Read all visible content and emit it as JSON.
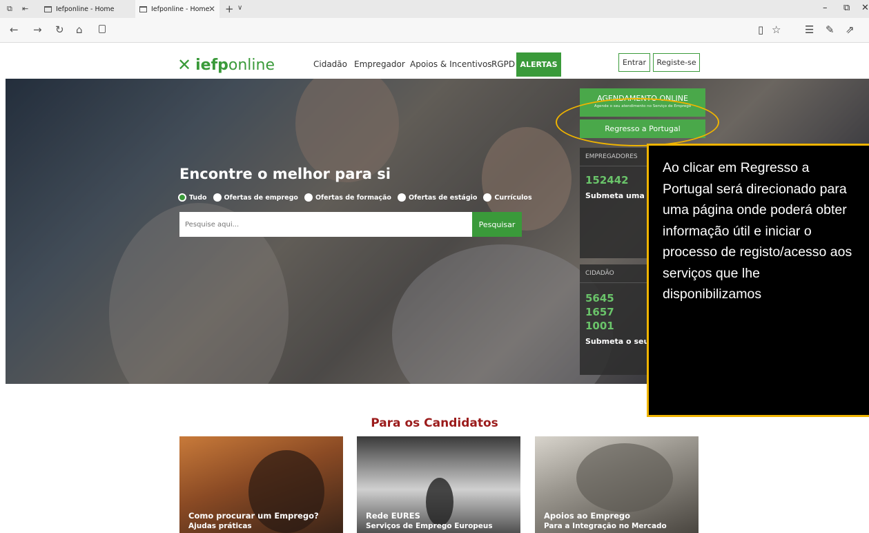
{
  "browser": {
    "tabs": [
      {
        "label": "Iefponline - Home"
      },
      {
        "label": "Iefponline - Home"
      }
    ],
    "new_tab_symbol": "+",
    "dropdown_symbol": "∨",
    "close_symbol": "✕",
    "address": ""
  },
  "site": {
    "logo_text_bold": "iefp",
    "logo_text_light": "online",
    "nav": [
      "Cidadão",
      "Empregador",
      "Apoios & Incentivos",
      "RGPD",
      "ALERTAS"
    ],
    "login_label": "Entrar",
    "register_label": "Registe-se"
  },
  "hero": {
    "title": "Encontre o melhor para si",
    "filters": [
      "Tudo",
      "Ofertas de emprego",
      "Ofertas de formação",
      "Ofertas de estágio",
      "Currículos"
    ],
    "search_placeholder": "Pesquise aqui...",
    "search_button": "Pesquisar"
  },
  "side": {
    "agendamento_title": "AGENDAMENTO ONLINE",
    "agendamento_sub": "Agende o seu atendimento no Serviço de Emprego",
    "regresso_label": "Regresso a Portugal",
    "empregadores": {
      "head": "EMPREGADORES",
      "values": [
        "152442"
      ],
      "cta": "Submeta uma"
    },
    "cidadao": {
      "head": "CIDADÃO",
      "values": [
        "5645",
        "1657",
        "1001"
      ],
      "cta": "Submeta o seu"
    }
  },
  "callout": {
    "text": "Ao clicar em Regresso a Portugal será direcionado para uma página onde poderá obter informação útil e iniciar o processo de registo/acesso aos serviços que lhe disponibilizamos"
  },
  "candidatos": {
    "title": "Para os Candidatos",
    "cards": [
      {
        "title": "Como procurar um Emprego?",
        "sub": "Ajudas práticas"
      },
      {
        "title": "Rede EURES",
        "sub": "Serviços de Emprego Europeus"
      },
      {
        "title": "Apoios ao Emprego",
        "sub": "Para a Integração no Mercado"
      }
    ]
  },
  "colors": {
    "brand_green": "#3a9a3a",
    "highlight": "#f0b400",
    "section_title": "#9b1b1b"
  }
}
